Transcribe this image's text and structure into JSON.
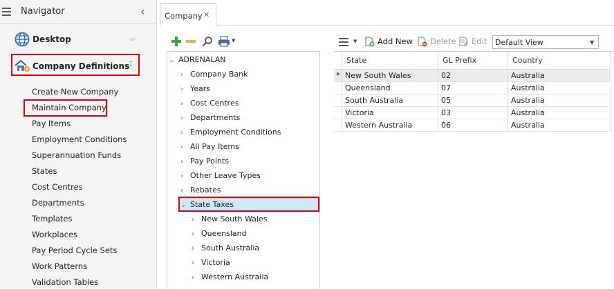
{
  "navigator": {
    "title": "Navigator",
    "sections": [
      {
        "label": "Desktop",
        "icon": "globe-icon",
        "expanded": false
      },
      {
        "label": "Company Definitions",
        "icon": "company-house-icon",
        "expanded": true
      }
    ],
    "items": [
      "Create New Company",
      "Maintain Company",
      "Pay Items",
      "Employment Conditions",
      "Superannuation Funds",
      "States",
      "Cost Centres",
      "Departments",
      "Templates",
      "Workplaces",
      "Pay Period Cycle Sets",
      "Work Patterns",
      "Validation Tables"
    ]
  },
  "tab": {
    "label": "Company",
    "close": "✕"
  },
  "tree": {
    "root": "ADRENALAN",
    "nodes": [
      "Company Bank",
      "Years",
      "Cost Centres",
      "Departments",
      "Employment Conditions",
      "All Pay Items",
      "Pay Points",
      "Other Leave Types",
      "Rebates",
      "State Taxes"
    ],
    "children": [
      "New South Wales",
      "Queensland",
      "South Australia",
      "Victoria",
      "Western Australia"
    ]
  },
  "grid_toolbar": {
    "add_label": "Add New",
    "delete_label": "Delete",
    "edit_label": "Edit",
    "view_value": "Default View"
  },
  "grid": {
    "columns": [
      "State",
      "GL Prefix",
      "Country"
    ],
    "rows": [
      [
        "New South Wales",
        "02",
        "Australia"
      ],
      [
        "Queensland",
        "07",
        "Australia"
      ],
      [
        "South Australia",
        "05",
        "Australia"
      ],
      [
        "Victoria",
        "03",
        "Australia"
      ],
      [
        "Western Australia",
        "06",
        "Australia"
      ]
    ]
  },
  "colors": {
    "highlight_red": "#e00000",
    "selection_blue": "#cde8fb",
    "add_green": "#3aa335",
    "remove_yellow": "#e3b23c"
  }
}
